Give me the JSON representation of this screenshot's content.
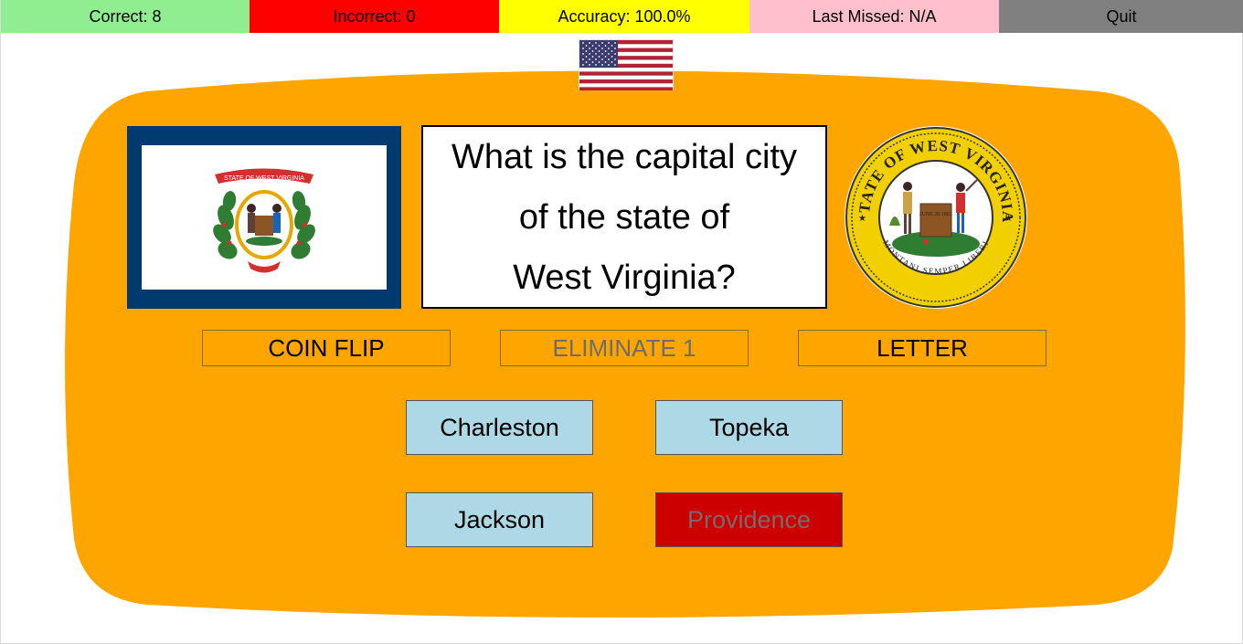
{
  "status_bar": {
    "correct": "Correct: 8",
    "incorrect": "Incorrect: 0",
    "accuracy": "Accuracy: 100.0%",
    "last_missed": "Last Missed: N/A",
    "quit": "Quit"
  },
  "question": {
    "line1": "What is the capital city",
    "line2": "of the state of",
    "line3": "West Virginia?"
  },
  "seal": {
    "top_text": "STATE OF WEST VIRGINIA",
    "bottom_text": "MONTANI SEMPER LIBERI",
    "rock_text": "JUNE 20 1863"
  },
  "state_flag": {
    "banner_text": "STATE OF WEST VIRGINIA"
  },
  "lifelines": {
    "coin_flip": "COIN FLIP",
    "eliminate": "ELIMINATE 1",
    "letter": "LETTER"
  },
  "answers": [
    {
      "label": "Charleston",
      "state": "available"
    },
    {
      "label": "Topeka",
      "state": "available"
    },
    {
      "label": "Jackson",
      "state": "available"
    },
    {
      "label": "Providence",
      "state": "eliminated"
    }
  ],
  "colors": {
    "correct_bg": "#90ee90",
    "incorrect_bg": "#ff0000",
    "accuracy_bg": "#ffff00",
    "last_missed_bg": "#ffc0cb",
    "quit_bg": "#808080",
    "panel": "#ffa500",
    "answer_bg": "#add8e6",
    "eliminated_bg": "#cc0000",
    "flag_border": "#003a6f"
  },
  "icons": {
    "us_flag": "us-flag-icon",
    "state_flag": "west-virginia-flag",
    "seal": "west-virginia-seal"
  }
}
